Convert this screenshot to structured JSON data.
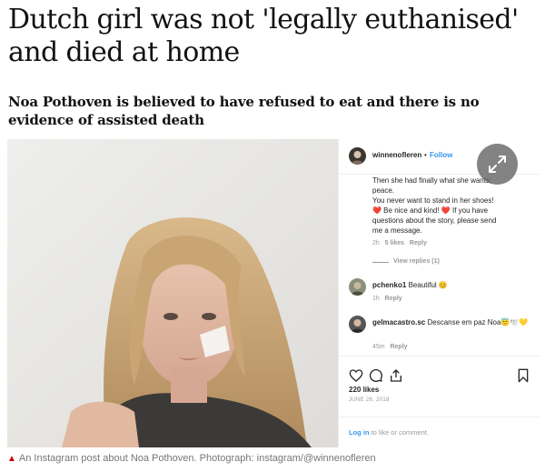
{
  "article": {
    "headline": "Dutch girl was not 'legally euthanised' and died at home",
    "standfirst": "Noa Pothoven is believed to have refused to eat and there is no evidence of assisted death",
    "caption": "An Instagram post about Noa Pothoven. Photograph: instagram/@winnenofleren",
    "caption_icon": "triangle-up-icon"
  },
  "instagram": {
    "username": "winnenofleren",
    "dot": "•",
    "follow_label": "Follow",
    "post_text_lines": [
      "Then she had finally what she wants;",
      "peace.",
      "You never want to stand in her shoes!",
      "❤️ Be nice and kind! ❤️ If you have",
      "questions about the story, please send",
      "me a message."
    ],
    "post_meta": {
      "time": "2h",
      "likes": "5 likes",
      "reply": "Reply"
    },
    "view_replies": "View replies (1)",
    "comments": [
      {
        "user": "pchenko1",
        "text": "Beautiful 😊",
        "time": "1h",
        "reply": "Reply"
      },
      {
        "user": "gelmacastro.sc",
        "text": "Descanse em paz Noa😇🕊️💛",
        "time": "45m",
        "reply": "Reply"
      }
    ],
    "likes": "220 likes",
    "date": "JUNE 26, 2018",
    "login_link": "Log in",
    "login_rest": " to like or comment."
  },
  "colors": {
    "link_blue": "#3897f0",
    "guardian_red": "#c70000",
    "caption_grey": "#767676",
    "text_dark": "#121212"
  },
  "icons": [
    "expand-icon",
    "heart-icon",
    "comment-icon",
    "share-icon",
    "bookmark-icon"
  ]
}
